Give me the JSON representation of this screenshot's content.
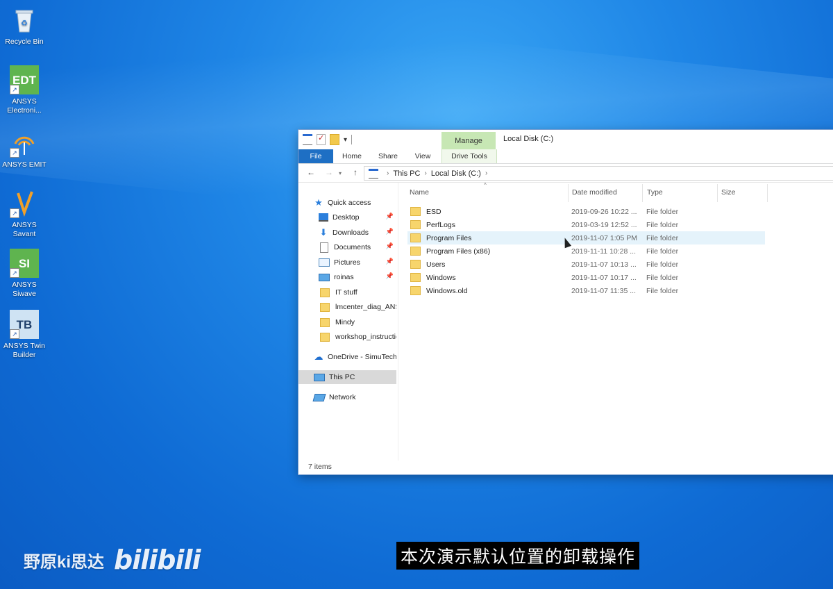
{
  "desktop": {
    "icons": [
      {
        "label": "Recycle Bin",
        "tile": ""
      },
      {
        "label": "ANSYS Electroni...",
        "tile": "EDT"
      },
      {
        "label": "ANSYS EMIT",
        "tile": ""
      },
      {
        "label": "ANSYS Savant",
        "tile": ""
      },
      {
        "label": "ANSYS Siwave",
        "tile": "SI"
      },
      {
        "label": "ANSYS Twin Builder",
        "tile": "TB"
      }
    ]
  },
  "window": {
    "title": "Local Disk (C:)",
    "context_tab": "Manage",
    "ribbon_tabs": [
      "File",
      "Home",
      "Share",
      "View",
      "Drive Tools"
    ],
    "breadcrumb": [
      "This PC",
      "Local Disk (C:)"
    ],
    "columns": [
      "Name",
      "Date modified",
      "Type",
      "Size"
    ],
    "sidebar": [
      {
        "label": "Quick access",
        "icon": "star-icon",
        "pinned": false
      },
      {
        "label": "Desktop",
        "icon": "desktop-icon",
        "pinned": true
      },
      {
        "label": "Downloads",
        "icon": "download-icon",
        "pinned": true
      },
      {
        "label": "Documents",
        "icon": "document-icon",
        "pinned": true
      },
      {
        "label": "Pictures",
        "icon": "pictures-icon",
        "pinned": true
      },
      {
        "label": "roinas",
        "icon": "monitor-icon",
        "pinned": true
      },
      {
        "label": "IT stuff",
        "icon": "folder-icon",
        "pinned": false
      },
      {
        "label": "lmcenter_diag_ANS",
        "icon": "folder-icon",
        "pinned": false
      },
      {
        "label": "Mindy",
        "icon": "folder-icon",
        "pinned": false
      },
      {
        "label": "workshop_instructio",
        "icon": "folder-icon",
        "pinned": false
      },
      {
        "label": "OneDrive - SimuTech",
        "icon": "cloud-icon",
        "pinned": false
      },
      {
        "label": "This PC",
        "icon": "pc-icon",
        "pinned": false,
        "selected": true
      },
      {
        "label": "Network",
        "icon": "network-icon",
        "pinned": false
      }
    ],
    "files": [
      {
        "name": "ESD",
        "date": "2019-09-26 10:22 ...",
        "type": "File folder"
      },
      {
        "name": "PerfLogs",
        "date": "2019-03-19 12:52 ...",
        "type": "File folder"
      },
      {
        "name": "Program Files",
        "date": "2019-11-07 1:05 PM",
        "type": "File folder",
        "hover": true
      },
      {
        "name": "Program Files (x86)",
        "date": "2019-11-11 10:28 ...",
        "type": "File folder"
      },
      {
        "name": "Users",
        "date": "2019-11-07 10:13 ...",
        "type": "File folder"
      },
      {
        "name": "Windows",
        "date": "2019-11-07 10:17 ...",
        "type": "File folder"
      },
      {
        "name": "Windows.old",
        "date": "2019-11-07 11:35 ...",
        "type": "File folder"
      }
    ],
    "status": "7 items"
  },
  "overlay": {
    "watermark_text": "野原ki思达",
    "watermark_logo": "bilibili",
    "subtitle": "本次演示默认位置的卸载操作"
  },
  "colors": {
    "desktop": "#1f86e6",
    "file_tab": "#1e6fc4",
    "manage_tab": "#c7e7b4"
  }
}
